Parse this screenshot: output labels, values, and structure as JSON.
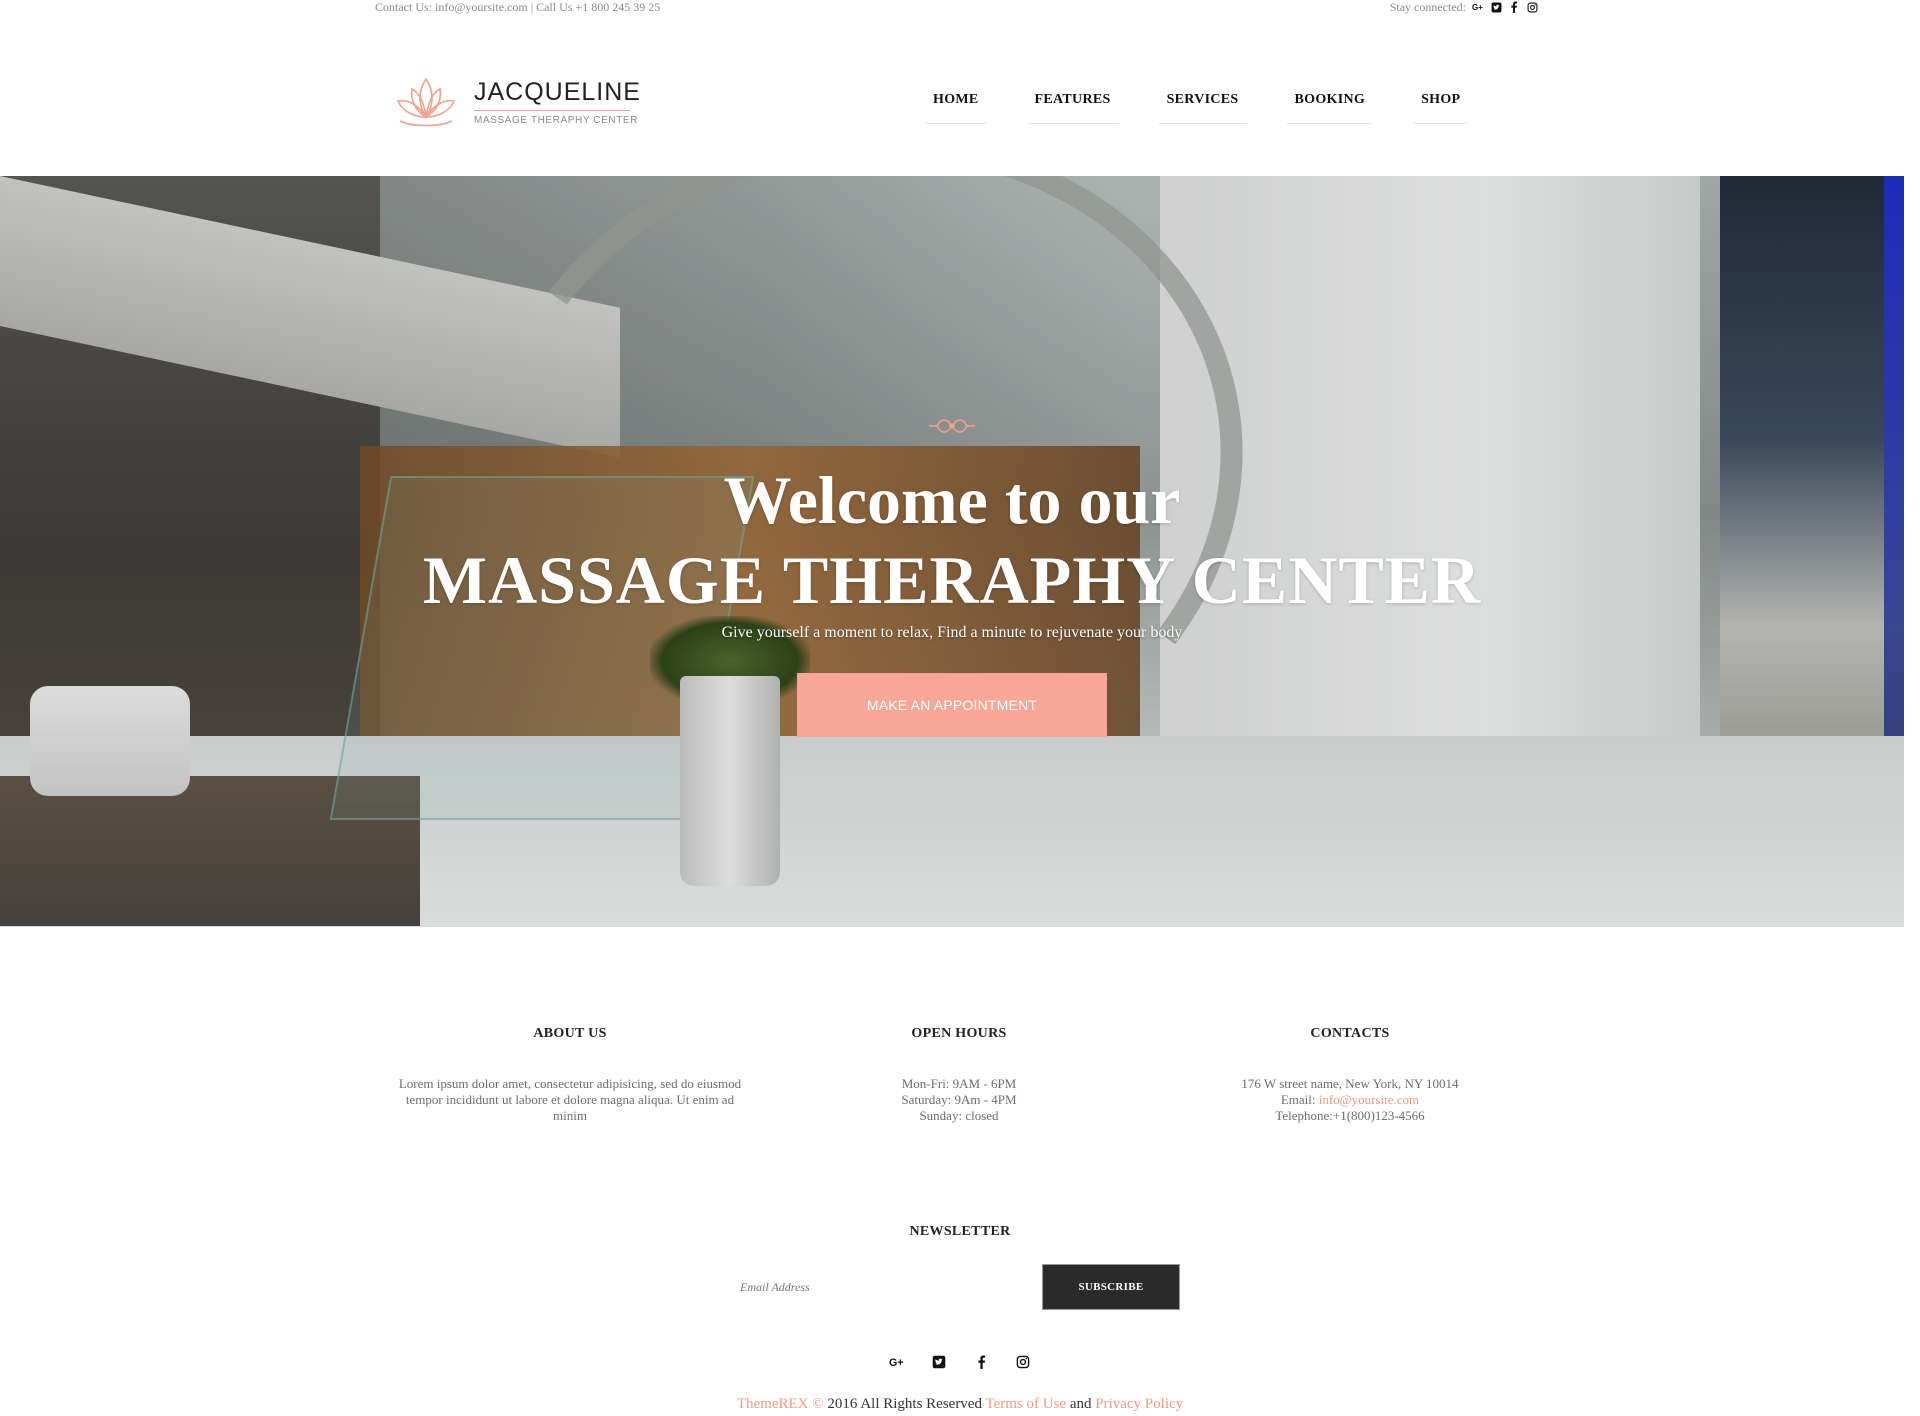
{
  "topbar": {
    "contact": "Contact Us: info@yoursite.com | Call Us +1 800 245 39 25",
    "stay_connected": "Stay connected:",
    "icons": [
      "google-plus-icon",
      "twitter-icon",
      "facebook-icon",
      "instagram-icon"
    ]
  },
  "logo": {
    "name": "JACQUELINE",
    "tagline": "MASSAGE THERAPHY CENTER"
  },
  "nav": {
    "items": [
      "HOME",
      "FEATURES",
      "SERVICES",
      "BOOKING",
      "SHOP"
    ]
  },
  "hero": {
    "title_line1": "Welcome to our",
    "title_line2": "MASSAGE THERAPHY CENTER",
    "subtitle": "Give yourself a moment to relax, Find a minute to rejuvenate your body",
    "cta": "MAKE AN APPOINTMENT"
  },
  "about": {
    "title": "ABOUT US",
    "line1": "Lorem ipsum dolor amet, consectetur adipisicing, sed do eiusmod",
    "line2": "tempor incididunt ut labore et dolore magna aliqua. Ut enim ad",
    "line3": "minim"
  },
  "hours": {
    "title": "OPEN HOURS",
    "line1": "Mon-Fri: 9AM - 6PM",
    "line2": "Saturday: 9Am - 4PM",
    "line3": "Sunday: closed"
  },
  "contacts": {
    "title": "CONTACTS",
    "address": "176 W street name, New York, NY 10014",
    "email_label": "Email:",
    "email": "info@yoursite.com",
    "telephone": "Telephone:+1(800)123-4566"
  },
  "newsletter": {
    "title": "NEWSLETTER",
    "placeholder": "Email Address",
    "button": "SUBSCRIBE"
  },
  "footer": {
    "brand": "ThemeREX ©",
    "rights": "2016 All Rights Reserved",
    "terms": "Terms of Use",
    "and": "and",
    "privacy": "Privacy Policy"
  },
  "colors": {
    "accent": "#f7a698",
    "link": "#f29785",
    "dark_button": "#2a2a2a"
  }
}
